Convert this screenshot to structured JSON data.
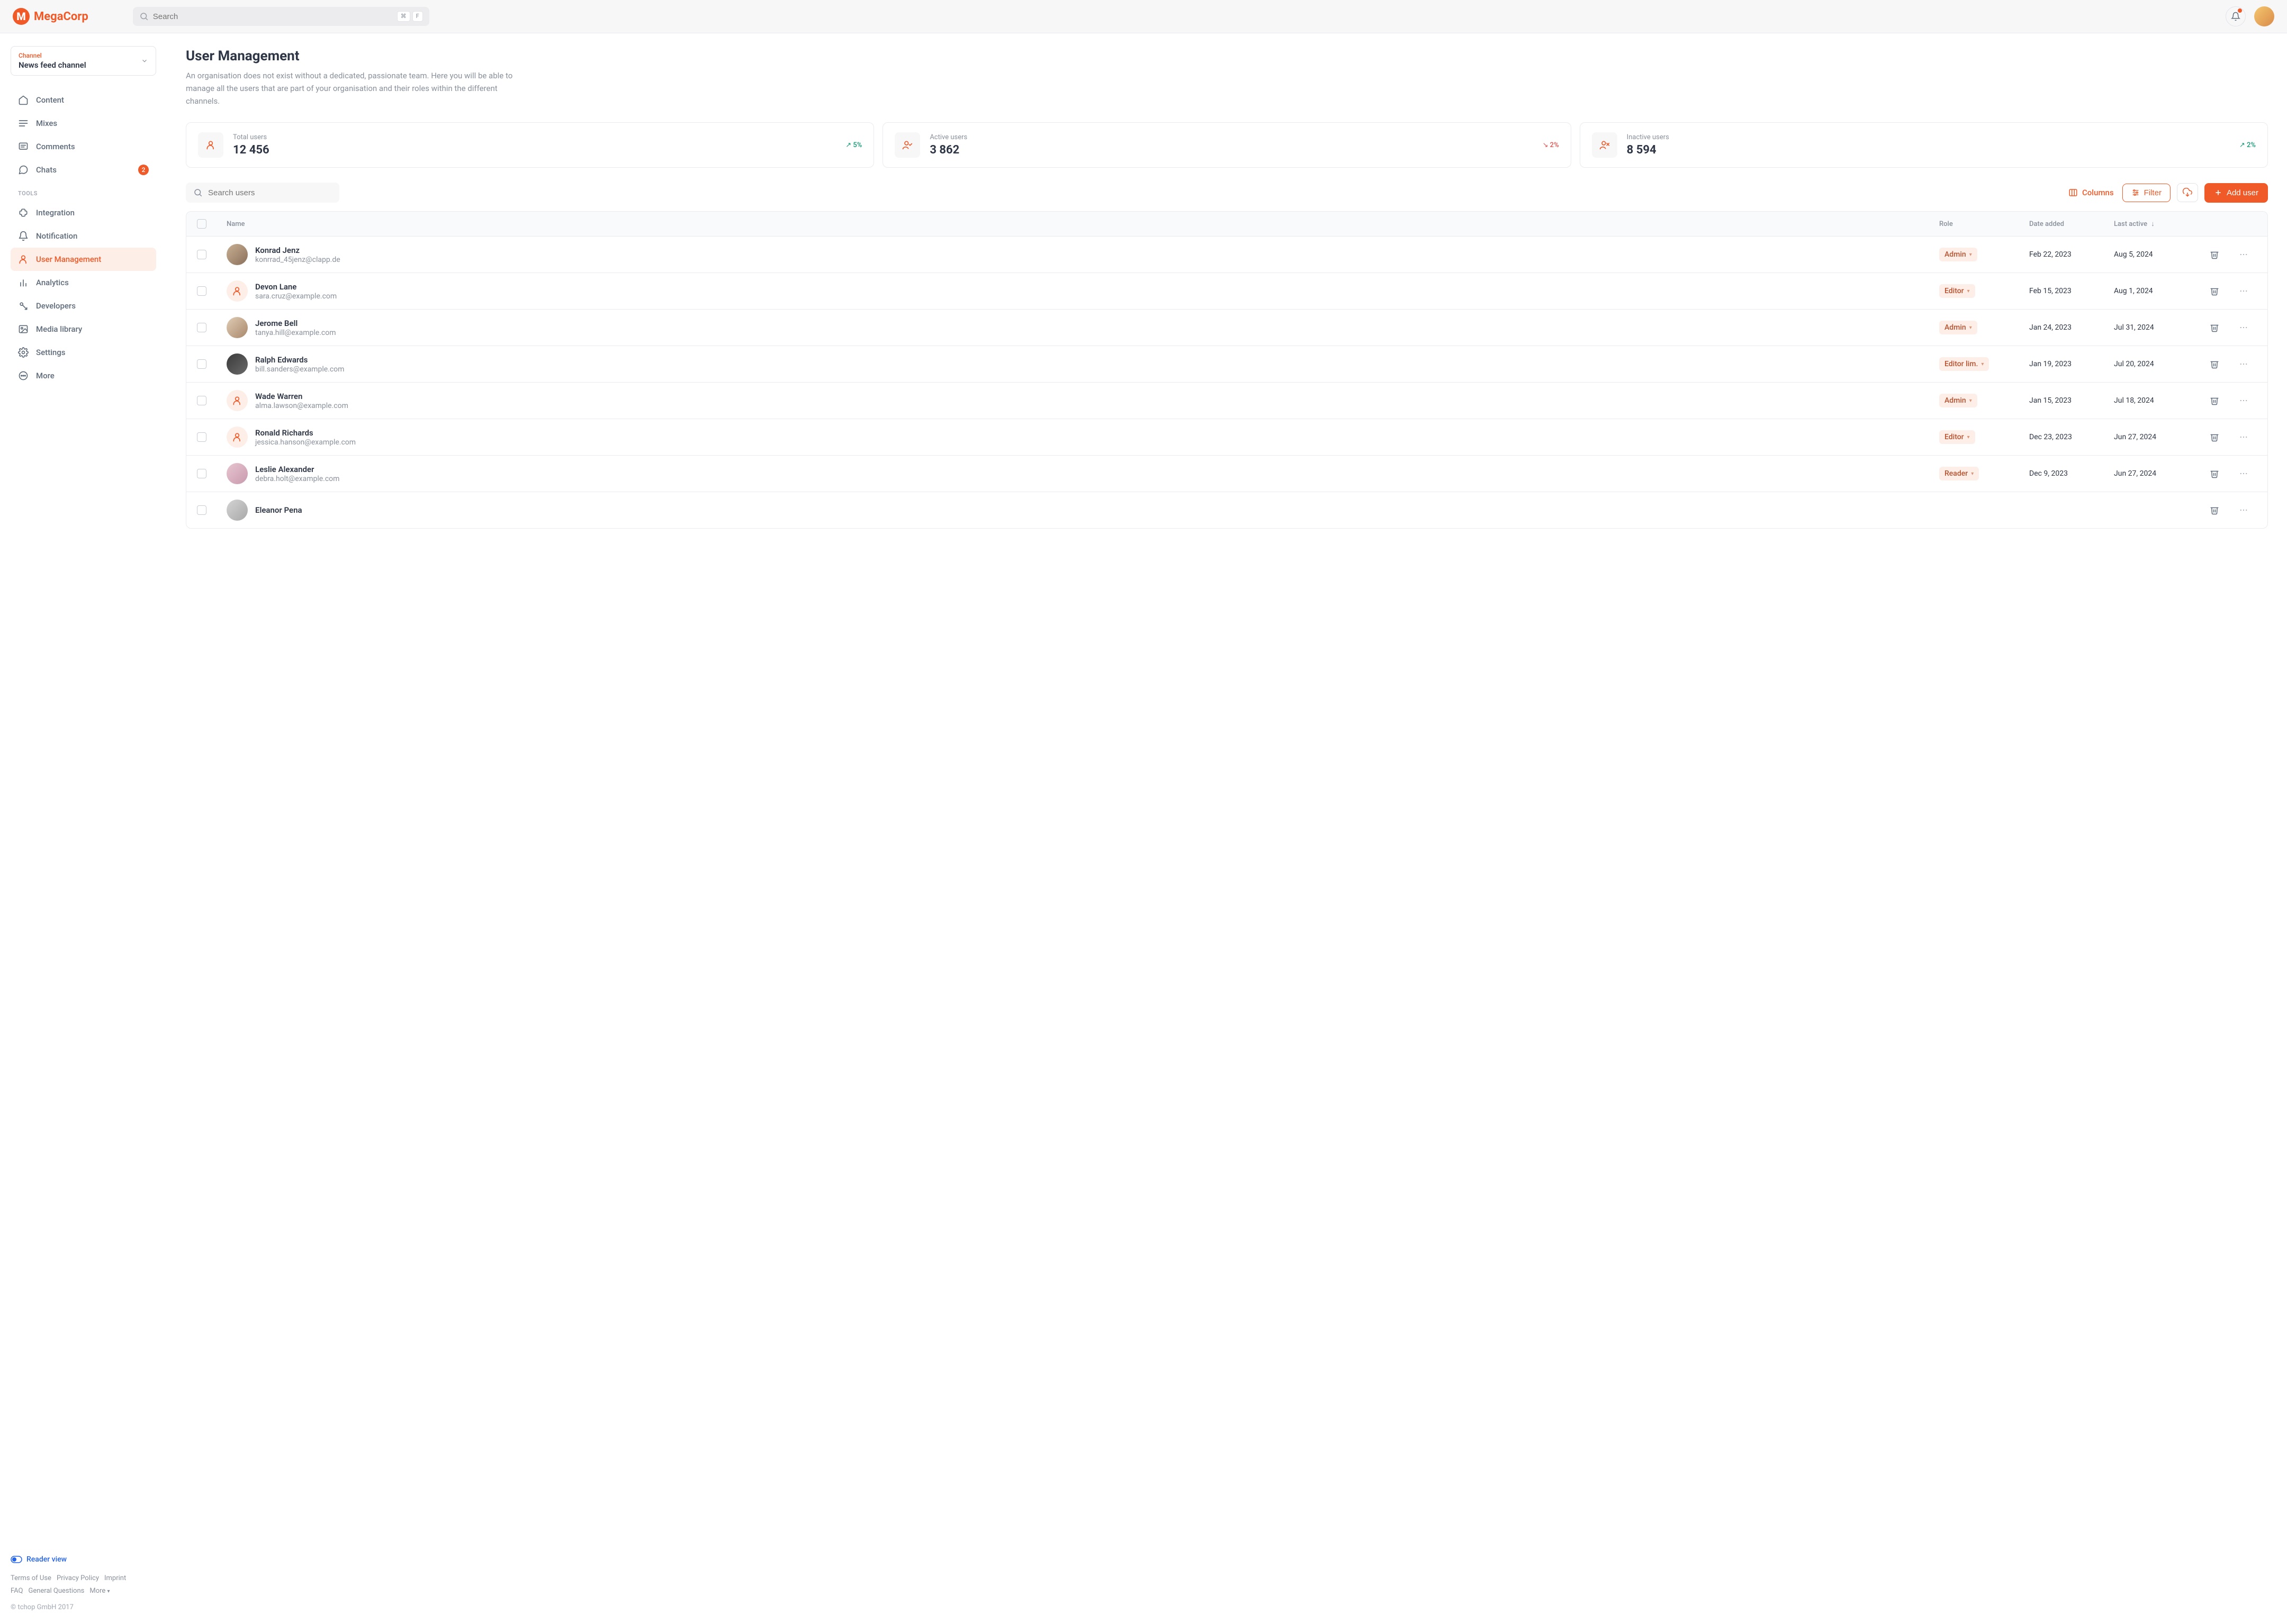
{
  "brand": {
    "name": "MegaCorp",
    "logo_letter": "M"
  },
  "topbar": {
    "search_placeholder": "Search",
    "kbd1": "⌘",
    "kbd2": "F"
  },
  "sidebar": {
    "channel_label": "Channel",
    "channel_value": "News feed channel",
    "nav_primary": [
      {
        "icon": "home",
        "label": "Content"
      },
      {
        "icon": "mixes",
        "label": "Mixes"
      },
      {
        "icon": "comments",
        "label": "Comments"
      },
      {
        "icon": "chats",
        "label": "Chats",
        "badge": "2"
      }
    ],
    "tools_label": "TOOLS",
    "nav_tools": [
      {
        "icon": "integration",
        "label": "Integration"
      },
      {
        "icon": "notification",
        "label": "Notification"
      },
      {
        "icon": "user-mgmt",
        "label": "User Management",
        "active": true
      },
      {
        "icon": "analytics",
        "label": "Analytics"
      },
      {
        "icon": "developers",
        "label": "Developers"
      },
      {
        "icon": "media",
        "label": "Media library"
      },
      {
        "icon": "settings",
        "label": "Settings"
      },
      {
        "icon": "more",
        "label": "More"
      }
    ],
    "reader_view": "Reader view",
    "footer_links_row1": [
      "Terms of Use",
      "Privacy Policy",
      "Imprint"
    ],
    "footer_links_row2": [
      "FAQ",
      "General Questions",
      "More"
    ],
    "copyright": "© tchop GmbH 2017"
  },
  "page": {
    "title": "User Management",
    "description": "An organisation does not exist without a dedicated, passionate team. Here you will be able to manage all the users that are part of your organisation and their roles within the different channels."
  },
  "stats": [
    {
      "label": "Total users",
      "value": "12 456",
      "change": "5%",
      "direction": "up"
    },
    {
      "label": "Active users",
      "value": "3 862",
      "change": "2%",
      "direction": "down"
    },
    {
      "label": "Inactive users",
      "value": "8 594",
      "change": "2%",
      "direction": "up"
    }
  ],
  "toolbar": {
    "search_placeholder": "Search users",
    "columns": "Columns",
    "filter": "Filter",
    "add_user": "Add user"
  },
  "table": {
    "headers": {
      "name": "Name",
      "role": "Role",
      "date_added": "Date added",
      "last_active": "Last active"
    },
    "rows": [
      {
        "name": "Konrad Jenz",
        "email": "konrrad_45jenz@clapp.de",
        "role": "Admin",
        "date_added": "Feb 22, 2023",
        "last_active": "Aug 5, 2024",
        "avatar": "photo1"
      },
      {
        "name": "Devon Lane",
        "email": "sara.cruz@example.com",
        "role": "Editor",
        "date_added": "Feb 15, 2023",
        "last_active": "Aug 1, 2024",
        "avatar": "icon"
      },
      {
        "name": "Jerome Bell",
        "email": "tanya.hill@example.com",
        "role": "Admin",
        "date_added": "Jan 24, 2023",
        "last_active": "Jul 31, 2024",
        "avatar": "photo2"
      },
      {
        "name": "Ralph Edwards",
        "email": "bill.sanders@example.com",
        "role": "Editor lim.",
        "date_added": "Jan 19, 2023",
        "last_active": "Jul 20, 2024",
        "avatar": "photo3"
      },
      {
        "name": "Wade Warren",
        "email": "alma.lawson@example.com",
        "role": "Admin",
        "date_added": "Jan 15, 2023",
        "last_active": "Jul 18, 2024",
        "avatar": "icon"
      },
      {
        "name": "Ronald Richards",
        "email": "jessica.hanson@example.com",
        "role": "Editor",
        "date_added": "Dec 23, 2023",
        "last_active": "Jun 27, 2024",
        "avatar": "icon"
      },
      {
        "name": "Leslie Alexander",
        "email": "debra.holt@example.com",
        "role": "Reader",
        "date_added": "Dec 9, 2023",
        "last_active": "Jun 27, 2024",
        "avatar": "photo4"
      },
      {
        "name": "Eleanor Pena",
        "email": "",
        "role": "",
        "date_added": "",
        "last_active": "",
        "avatar": "photo5"
      }
    ]
  }
}
